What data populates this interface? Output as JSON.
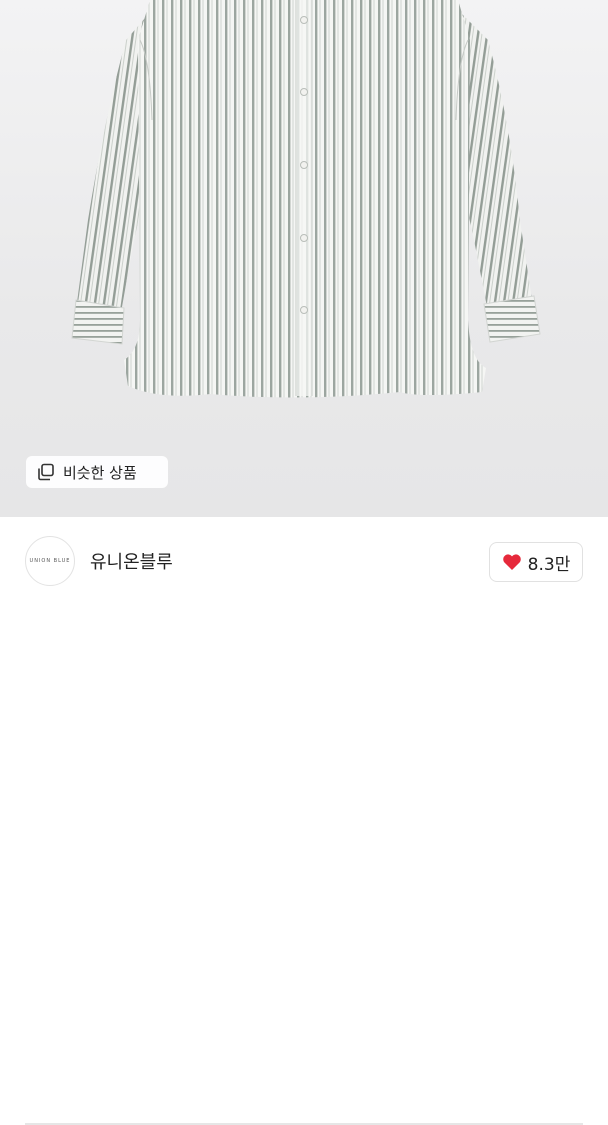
{
  "product_image": {
    "similar_button": {
      "label": "비슷한 상품",
      "icon": "copy-icon"
    }
  },
  "seller": {
    "avatar_text": "UNION BLUE",
    "name": "유니온블루"
  },
  "like": {
    "icon": "heart-icon",
    "color": "#e6293b",
    "count": "8.3만"
  }
}
